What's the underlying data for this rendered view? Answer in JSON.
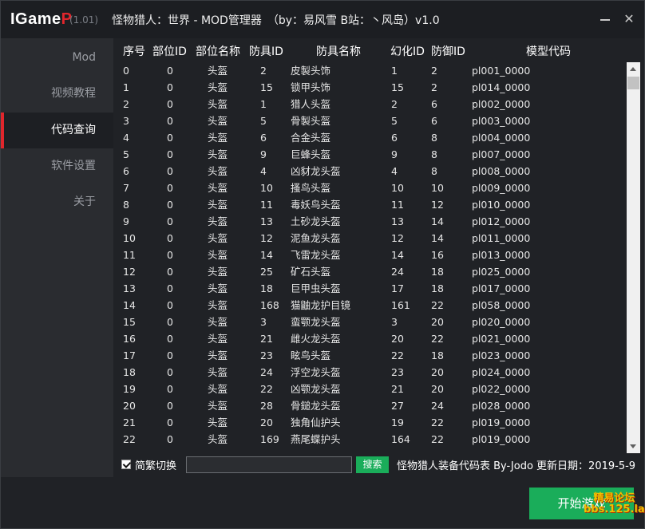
{
  "titlebar": {
    "logo_main": "IGame",
    "logo_accent": "P",
    "version": "(1.01)",
    "title": "怪物猎人：世界 - MOD管理器　（by：易风雪 B站：丶风岛）v1.0"
  },
  "sidebar": {
    "items": [
      {
        "label": "Mod"
      },
      {
        "label": "视频教程"
      },
      {
        "label": "代码查询"
      },
      {
        "label": "软件设置"
      },
      {
        "label": "关于"
      }
    ]
  },
  "table": {
    "headers": [
      "序号",
      "部位ID",
      "部位名称",
      "防具ID",
      "防具名称",
      "幻化ID",
      "防御ID",
      "模型代码"
    ],
    "rows": [
      [
        "0",
        "0",
        "头盔",
        "2",
        "皮製头饰",
        "1",
        "2",
        "pl001_0000"
      ],
      [
        "1",
        "0",
        "头盔",
        "15",
        "锁甲头饰",
        "15",
        "2",
        "pl014_0000"
      ],
      [
        "2",
        "0",
        "头盔",
        "1",
        "猎人头盔",
        "2",
        "6",
        "pl002_0000"
      ],
      [
        "3",
        "0",
        "头盔",
        "5",
        "骨製头盔",
        "5",
        "6",
        "pl003_0000"
      ],
      [
        "4",
        "0",
        "头盔",
        "6",
        "合金头盔",
        "6",
        "8",
        "pl004_0000"
      ],
      [
        "5",
        "0",
        "头盔",
        "9",
        "巨蜂头盔",
        "9",
        "8",
        "pl007_0000"
      ],
      [
        "6",
        "0",
        "头盔",
        "4",
        "凶豺龙头盔",
        "4",
        "8",
        "pl008_0000"
      ],
      [
        "7",
        "0",
        "头盔",
        "10",
        "搔鸟头盔",
        "10",
        "10",
        "pl009_0000"
      ],
      [
        "8",
        "0",
        "头盔",
        "11",
        "毒妖鸟头盔",
        "11",
        "12",
        "pl010_0000"
      ],
      [
        "9",
        "0",
        "头盔",
        "13",
        "土砂龙头盔",
        "13",
        "14",
        "pl012_0000"
      ],
      [
        "10",
        "0",
        "头盔",
        "12",
        "泥鱼龙头盔",
        "12",
        "14",
        "pl011_0000"
      ],
      [
        "11",
        "0",
        "头盔",
        "14",
        "飞雷龙头盔",
        "14",
        "16",
        "pl013_0000"
      ],
      [
        "12",
        "0",
        "头盔",
        "25",
        "矿石头盔",
        "24",
        "18",
        "pl025_0000"
      ],
      [
        "13",
        "0",
        "头盔",
        "18",
        "巨甲虫头盔",
        "17",
        "18",
        "pl017_0000"
      ],
      [
        "14",
        "0",
        "头盔",
        "168",
        "猫鼬龙护目镜",
        "161",
        "22",
        "pl058_0000"
      ],
      [
        "15",
        "0",
        "头盔",
        "3",
        "蛮颚龙头盔",
        "3",
        "20",
        "pl020_0000"
      ],
      [
        "16",
        "0",
        "头盔",
        "21",
        "雌火龙头盔",
        "20",
        "22",
        "pl021_0000"
      ],
      [
        "17",
        "0",
        "头盔",
        "23",
        "眩鸟头盔",
        "22",
        "18",
        "pl023_0000"
      ],
      [
        "18",
        "0",
        "头盔",
        "24",
        "浮空龙头盔",
        "23",
        "20",
        "pl024_0000"
      ],
      [
        "19",
        "0",
        "头盔",
        "22",
        "凶颚龙头盔",
        "21",
        "20",
        "pl022_0000"
      ],
      [
        "20",
        "0",
        "头盔",
        "28",
        "骨鎚龙头盔",
        "27",
        "24",
        "pl028_0000"
      ],
      [
        "21",
        "0",
        "头盔",
        "20",
        "独角仙护头",
        "19",
        "22",
        "pl019_0000"
      ],
      [
        "22",
        "0",
        "头盔",
        "169",
        "燕尾蝶护头",
        "164",
        "22",
        "pl019_0000"
      ]
    ]
  },
  "bottom": {
    "toggle_label": "简繁切换",
    "search_placeholder": "",
    "search_button": "搜索",
    "info": "怪物猎人装备代码表 By-Jodo 更新日期：2019-5-9"
  },
  "footer": {
    "start_button": "开始游戏",
    "watermark_line1": "精易论坛",
    "watermark_line2": "bbs.125.la"
  },
  "colors": {
    "accent_red": "#e0262c",
    "accent_green": "#1aad5a",
    "background": "#202226",
    "sidebar": "#2a2c30"
  }
}
